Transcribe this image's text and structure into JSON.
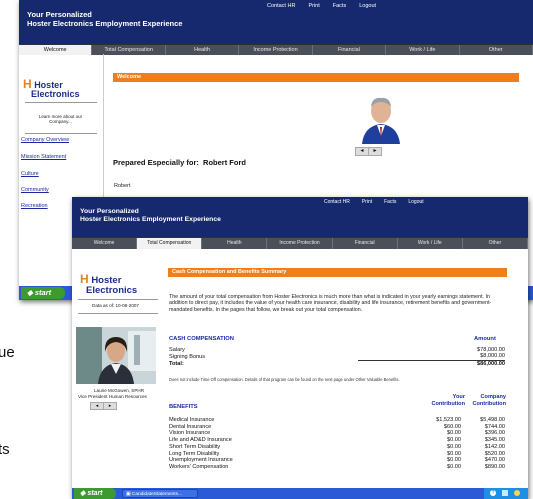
{
  "app": {
    "title_line1": "Your Personalized",
    "title_line2": "Hoster Electronics Employment Experience",
    "topnav": [
      "Contact HR",
      "Print",
      "Facts",
      "Logout"
    ],
    "tabs": [
      "Welcome",
      "Total Compensation",
      "Health",
      "Income Protection",
      "Financial",
      "Work / Life",
      "Other"
    ],
    "logo_top": "Hoster",
    "logo_bottom": "Electronics"
  },
  "back_window": {
    "active_tab": "Welcome",
    "sidebar_blurb": "Learn more about our Company...",
    "sidebar_links": [
      "Company Overview",
      "Mission Statement",
      "Culture",
      "Community",
      "Recreation"
    ],
    "section_title": "Welcome",
    "prepared_for": "Prepared Especially for:  Robert Ford",
    "greeting": "Robert",
    "start_label": "start",
    "photo_prev": "◂",
    "photo_next": "▸"
  },
  "front_window": {
    "active_tab": "Total Compensation",
    "date_note": "Data as of: 10-08-2007",
    "person_name": "Laurie McGowen, SPHR",
    "person_title": "Vice President Human Resources",
    "section_title": "Cash Compensation and Benefits Summary",
    "intro": "The amount of your total compensation from Hoster Electronics is much more than what is indicated in your yearly earnings statement. In addition to direct pay, it includes the value of your health care insurance, disability and life insurance, retirement benefits and government-mandated benefits. In the pages that follow, we break out your total compensation.",
    "cash": {
      "heading": "CASH COMPENSATION",
      "amount_label": "Amount",
      "rows": [
        {
          "label": "Salary",
          "amount": "$78,000.00"
        },
        {
          "label": "Signing Bonus",
          "amount": "$8,000.00"
        }
      ],
      "total_label": "Total:",
      "total_amount": "$86,000.00",
      "footnote": "Does not include Time Off compensation. Details of that program can be found on the next page under Other Valuable Benefits."
    },
    "benefits": {
      "heading": "BENEFITS",
      "col1_line1": "Your",
      "col1_line2": "Contribution",
      "col2_line1": "Company",
      "col2_line2": "Contribution",
      "rows": [
        {
          "label": "Medical Insurance",
          "yours": "$1,523.00",
          "company": "$5,498.00"
        },
        {
          "label": "Dental Insurance",
          "yours": "$60.00",
          "company": "$744.00"
        },
        {
          "label": "Vision Insurance",
          "yours": "$0.00",
          "company": "$396.00"
        },
        {
          "label": "Life and AD&D Insurance",
          "yours": "$0.00",
          "company": "$345.00"
        },
        {
          "label": "Short Term Disability",
          "yours": "$0.00",
          "company": "$142.00"
        },
        {
          "label": "Long Term Disability",
          "yours": "$0.00",
          "company": "$520.00"
        },
        {
          "label": "Unemployment Insurance",
          "yours": "$0.00",
          "company": "$470.00"
        },
        {
          "label": "Workers' Compensation",
          "yours": "$0.00",
          "company": "$890.00"
        }
      ]
    },
    "taskbar": {
      "start_label": "start",
      "task_item": "CandidateStatements..."
    }
  },
  "stray_text": [
    "ue",
    "ts"
  ]
}
